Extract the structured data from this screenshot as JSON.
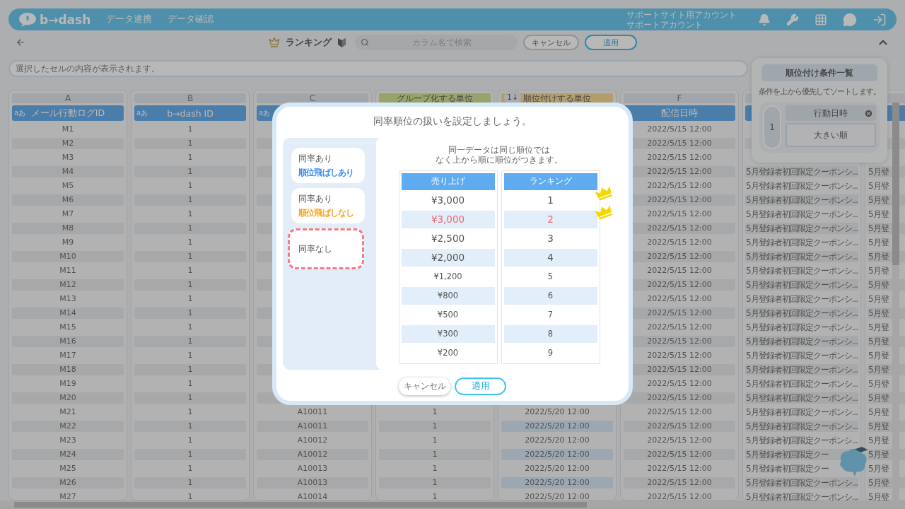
{
  "app": {
    "logo": "b→dash",
    "menu": [
      "データ連携",
      "データ確認"
    ],
    "account": [
      "サポートサイト用アカウント",
      "サポートアカウント"
    ]
  },
  "toolbar": {
    "title": "ランキング",
    "search": {
      "placeholder": "カラム名で検索"
    },
    "buttons": [
      {
        "label": "キャンセル",
        "kind": "secondary"
      },
      {
        "label": "適用",
        "kind": "primary"
      }
    ]
  },
  "cell_preview": {
    "placeholder": "選択したセルの内容が表示されます。"
  },
  "columns": [
    {
      "letter": "A",
      "type": "aあ",
      "header": "メール行動ログID",
      "kind": "plain",
      "cells": [
        "M1",
        "M2",
        "M3",
        "M4",
        "M5",
        "M6",
        "M7",
        "M8",
        "M9",
        "M10",
        "M11",
        "M12",
        "M13",
        "M14",
        "M15",
        "M16",
        "M17",
        "M18",
        "M19",
        "M20",
        "M21",
        "M22",
        "M23",
        "M24",
        "M25",
        "M26",
        "M27"
      ]
    },
    {
      "letter": "B",
      "type": "aあ",
      "header": "b→dash ID",
      "kind": "plain",
      "cells": [
        "1",
        "1",
        "1",
        "1",
        "1",
        "1",
        "1",
        "1",
        "1",
        "1",
        "1",
        "1",
        "1",
        "1",
        "1",
        "1",
        "1",
        "1",
        "1",
        "1",
        "1",
        "1",
        "1",
        "1",
        "1",
        "1",
        "1"
      ]
    },
    {
      "letter": "C",
      "type": "aあ",
      "kind": "plain",
      "cells": [
        "A10011",
        "A10011",
        "A10012",
        "A10012",
        "A10013",
        "A10013",
        "A10014"
      ]
    },
    {
      "tag": {
        "text": "グループ化する単位",
        "kind": "group"
      },
      "kind": "plain",
      "cells": [
        "1",
        "1",
        "1",
        "1",
        "1",
        "1",
        "1"
      ]
    },
    {
      "tag": {
        "text": "順位付けする単位",
        "kind": "rank",
        "badge": "1↓"
      },
      "kind": "rank",
      "cells": [
        "2022/5/20 12:00",
        "2022/5/20 12:00",
        "2022/5/20 12:00",
        "2022/5/20 12:00",
        "2022/5/20 12:00",
        "2022/5/20 12:00",
        "2022/5/20 12:00"
      ]
    },
    {
      "letter": "F",
      "header": "配信日時",
      "kind": "plain",
      "cells": [
        "2022/5/15 12:00",
        "2022/5/15 12:00",
        "2022/5/15 12:00",
        "2022/5/15 12:00",
        "2022/5/15 12:00",
        "2022/5/15 12:00",
        "2022/5/15 12:00",
        "2022/5/15 12:00",
        "2022/5/15 12:00",
        "2022/5/15 12:00",
        "2022/5/15 12:00",
        "2022/5/15 12:00",
        "2022/5/15 12:00",
        "2022/5/15 12:00",
        "2022/5/15 12:00",
        "2022/5/15 12:00",
        "2022/5/15 12:00",
        "2022/5/15 12:00",
        "2022/5/15 12:00",
        "2022/5/15 12:00",
        "2022/5/15 12:00",
        "2022/5/15 12:00",
        "2022/5/15 12:00",
        "2022/5/15 12:00",
        "2022/5/15 12:00",
        "2022/5/15 12:00",
        "2022/5/15 12:00"
      ]
    },
    {
      "kind": "long_text",
      "cells": [
        "5月登録者初回限定クーポンシ...",
        "5月登録者初回限定クーポンシ...",
        "5月登録者初回限定クーポンシ...",
        "5月登録者初回限定クーポンシ...",
        "5月登録者初回限定クーポンシ...",
        "5月登録者初回限定クーポンシ...",
        "5月登録者初回限定クーポンシ...",
        "5月登録者初回限定クーポンシ...",
        "5月登録者初回限定クーポンシ...",
        "5月登録者初回限定クーポンシ...",
        "5月登録者初回限定クーポンシ...",
        "5月登録者初回限定クーポンシ...",
        "5月登録者初回限定クーポンシ...",
        "5月登録者初回限定クーポンシ...",
        "5月登録者初回限定クーポンシ...",
        "5月登録者初回限定クーポンシ...",
        "5月登録者初回限定クーポンシ...",
        "5月登録者初回限定クーポンシ...",
        "5月登録者初回限定クーポンシ...",
        "5月登録者初回限定クーポンシ...",
        "5月登録者初回限定クー",
        "5月登録者初回限定クー",
        "5月登録者初回限定クーポンシ...",
        "5月登録者初回限定クーポンシ..."
      ]
    },
    {
      "kind": "long_text",
      "cells": [
        "5月登",
        "5月登",
        "5月登",
        "5月登",
        "5月登",
        "5月登",
        "5月登",
        "5月登",
        "5月登",
        "5月登",
        "5月登",
        "5月登",
        "5月登",
        "5月登",
        "5月登",
        "5月登",
        "5月登",
        "5月登",
        "5月登",
        "5月登",
        "5月登",
        "5月登",
        "5月登",
        "5月登"
      ]
    }
  ],
  "ranking_panel": {
    "title": "順位付け条件一覧",
    "note": "条件を上から優先してソートします。",
    "conditions": [
      {
        "order": "1",
        "column": "行動日時",
        "direction": "大きい順"
      }
    ]
  },
  "dialog": {
    "title": "同率順位の扱いを設定しましょう。",
    "options": [
      {
        "label": "同率あり",
        "sub": "順位飛ばしあり",
        "color": "#3d8ff0",
        "selected": false
      },
      {
        "label": "同率あり",
        "sub": "順位飛ばしなし",
        "color": "#f5a623",
        "selected": false
      },
      {
        "label": "同率なし",
        "selected": true
      }
    ],
    "description": [
      "同一データは同じ順位では",
      "なく上から順に順位がつきます。"
    ],
    "table": {
      "columns": [
        "売り上げ",
        "ランキング"
      ],
      "rows": [
        {
          "sales": "¥3,000",
          "rank": "1",
          "large": true,
          "tied": false,
          "crown": true
        },
        {
          "sales": "¥3,000",
          "rank": "2",
          "large": true,
          "tied": true,
          "crown": true
        },
        {
          "sales": "¥2,500",
          "rank": "3",
          "large": true,
          "tied": false,
          "crown": false
        },
        {
          "sales": "¥2,000",
          "rank": "4",
          "large": true,
          "tied": false,
          "crown": false
        },
        {
          "sales": "¥1,200",
          "rank": "5",
          "large": false,
          "tied": false,
          "crown": false
        },
        {
          "sales": "¥800",
          "rank": "6",
          "large": false,
          "tied": false,
          "crown": false
        },
        {
          "sales": "¥500",
          "rank": "7",
          "large": false,
          "tied": false,
          "crown": false
        },
        {
          "sales": "¥300",
          "rank": "8",
          "large": false,
          "tied": false,
          "crown": false
        },
        {
          "sales": "¥200",
          "rank": "9",
          "large": false,
          "tied": false,
          "crown": false
        }
      ]
    },
    "buttons": [
      {
        "label": "キャンセル",
        "kind": "secondary"
      },
      {
        "label": "適用",
        "kind": "primary"
      }
    ]
  }
}
